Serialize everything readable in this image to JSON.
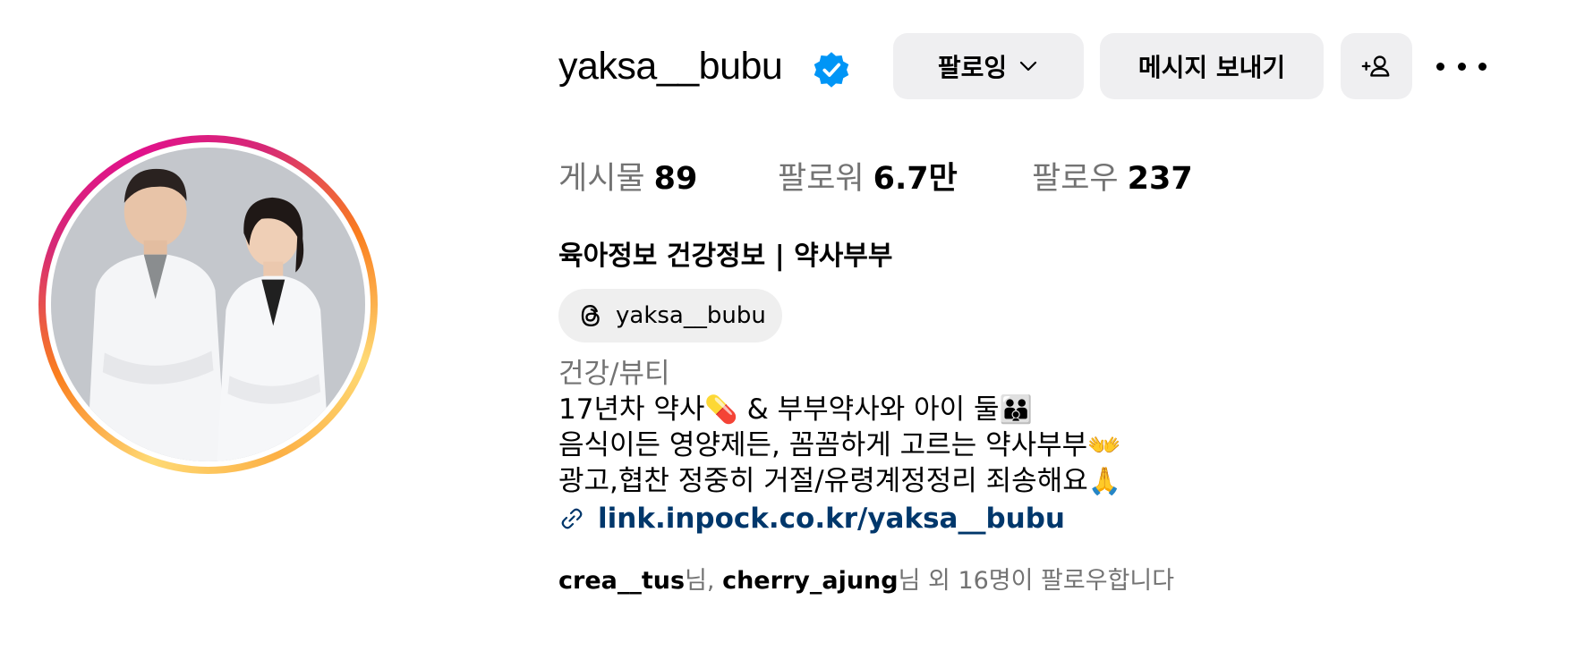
{
  "profile": {
    "username": "yaksa__bubu",
    "verified_icon": "verified-badge-icon",
    "accent_color": "#0095f6"
  },
  "actions": {
    "following_label": "팔로잉",
    "message_label": "메시지 보내기",
    "add_user_label": "+",
    "more_icon": "more-horizontal-icon"
  },
  "stats": {
    "posts_label": "게시물",
    "posts_value": "89",
    "followers_label": "팔로워",
    "followers_value": "6.7만",
    "following_label": "팔로우",
    "following_value": "237"
  },
  "bio": {
    "full_name": "육아정보 건강정보 | 약사부부",
    "threads_handle": "yaksa__bubu",
    "category": "건강/뷰티",
    "line1_text": "17년차 약사",
    "line1_emoji1": "💊",
    "line1_text2": " & 부부약사와 아이 둘",
    "line1_emoji2": "👪",
    "line2_text": "음식이든 영양제든, 꼼꼼하게 고르는 약사부부",
    "line2_emoji": "👐",
    "line3_text": "광고,협찬 정중히 거절/유령계정정리 죄송해요",
    "line3_emoji": "🙏",
    "link": "link.inpock.co.kr/yaksa__bubu",
    "link_color": "#00376b"
  },
  "followed_by": {
    "user1": "crea__tus",
    "suffix1": "님, ",
    "user2": "cherry_ajung",
    "suffix2": "님 외 16명이 팔로우합니다"
  }
}
